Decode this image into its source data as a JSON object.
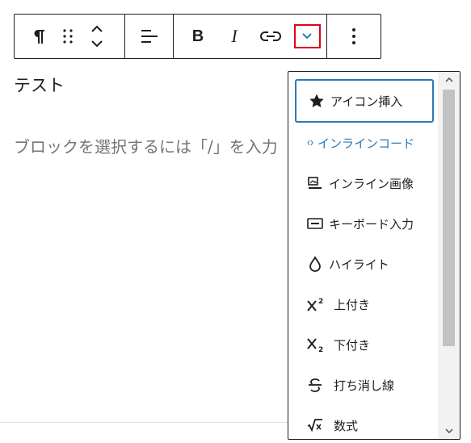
{
  "toolbar": {
    "bold_label": "B",
    "italic_label": "I",
    "colors": {
      "highlight_border": "#e0001a"
    },
    "icons": [
      "paragraph-icon",
      "drag-handle-icon",
      "move-up-down-icon",
      "align-icon",
      "link-icon",
      "chevron-down-icon",
      "more-options-icon"
    ]
  },
  "editor": {
    "heading_text": "テスト",
    "placeholder": "ブロックを選択するには「/」を入力"
  },
  "dropdown": {
    "items": [
      {
        "label": "アイコン挿入",
        "icon": "star-icon"
      },
      {
        "label": "インラインコード",
        "icon": "code-icon"
      },
      {
        "label": "インライン画像",
        "icon": "inline-image-icon"
      },
      {
        "label": "キーボード入力",
        "icon": "keyboard-icon"
      },
      {
        "label": "ハイライト",
        "icon": "drop-icon"
      },
      {
        "label": "上付き",
        "icon": "superscript-icon"
      },
      {
        "label": "下付き",
        "icon": "subscript-icon"
      },
      {
        "label": "打ち消し線",
        "icon": "strikethrough-icon"
      },
      {
        "label": "数式",
        "icon": "math-icon"
      }
    ],
    "colors": {
      "focus_border": "#2a79b8",
      "accent_text": "#2a79b8"
    }
  }
}
